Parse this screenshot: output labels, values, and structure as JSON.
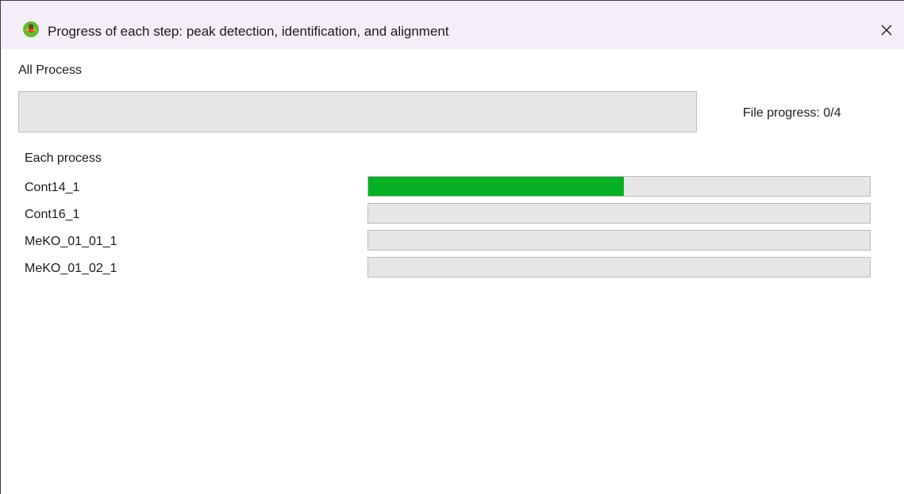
{
  "window": {
    "title": "Progress of each step: peak detection, identification, and alignment",
    "close_glyph": "✕",
    "icon": "msdial-app-icon"
  },
  "overall": {
    "label": "All Process",
    "progress_fraction": 0,
    "file_progress_text": "File progress: 0/4"
  },
  "each_process": {
    "label": "Each process",
    "items": [
      {
        "name": "Cont14_1",
        "progress_fraction": 0.51
      },
      {
        "name": "Cont16_1",
        "progress_fraction": 0
      },
      {
        "name": "MeKO_01_01_1",
        "progress_fraction": 0
      },
      {
        "name": "MeKO_01_02_1",
        "progress_fraction": 0
      }
    ]
  },
  "colors": {
    "progress_fill": "#06b025",
    "progress_track": "#e6e6e6",
    "titlebar_bg": "#f3eef7"
  }
}
